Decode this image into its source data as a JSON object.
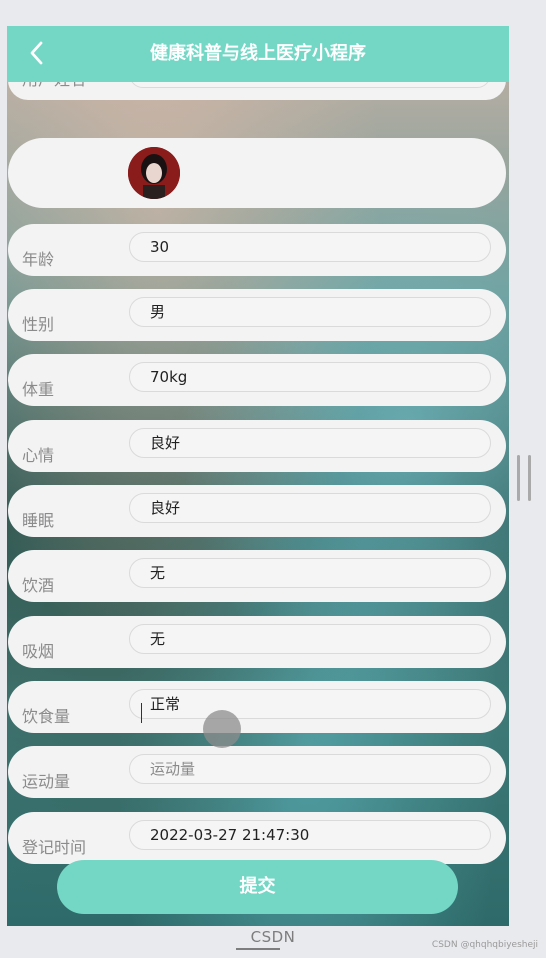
{
  "navbar": {
    "title": "健康科普与线上医疗小程序",
    "back_icon": "chevron-left-icon"
  },
  "form": {
    "top_cut_label": "用户姓名",
    "avatar_icon": "user-avatar",
    "fields": [
      {
        "label": "年龄",
        "value": "30"
      },
      {
        "label": "性别",
        "value": "男"
      },
      {
        "label": "体重",
        "value": "70kg"
      },
      {
        "label": "心情",
        "value": "良好"
      },
      {
        "label": "睡眠",
        "value": "良好"
      },
      {
        "label": "饮酒",
        "value": "无"
      },
      {
        "label": "吸烟",
        "value": "无"
      },
      {
        "label": "饮食量",
        "value": "正常"
      },
      {
        "label": "运动量",
        "placeholder": "运动量",
        "value": ""
      },
      {
        "label": "登记时间",
        "value": "2022-03-27 21:47:30"
      }
    ],
    "submit_label": "提交"
  },
  "watermark": {
    "center": "CSDN",
    "right": "CSDN @qhqhqbiyesheji"
  },
  "colors": {
    "accent": "#74d7c5",
    "row_bg": "#f3f3f4",
    "label": "#8b8b8b"
  }
}
